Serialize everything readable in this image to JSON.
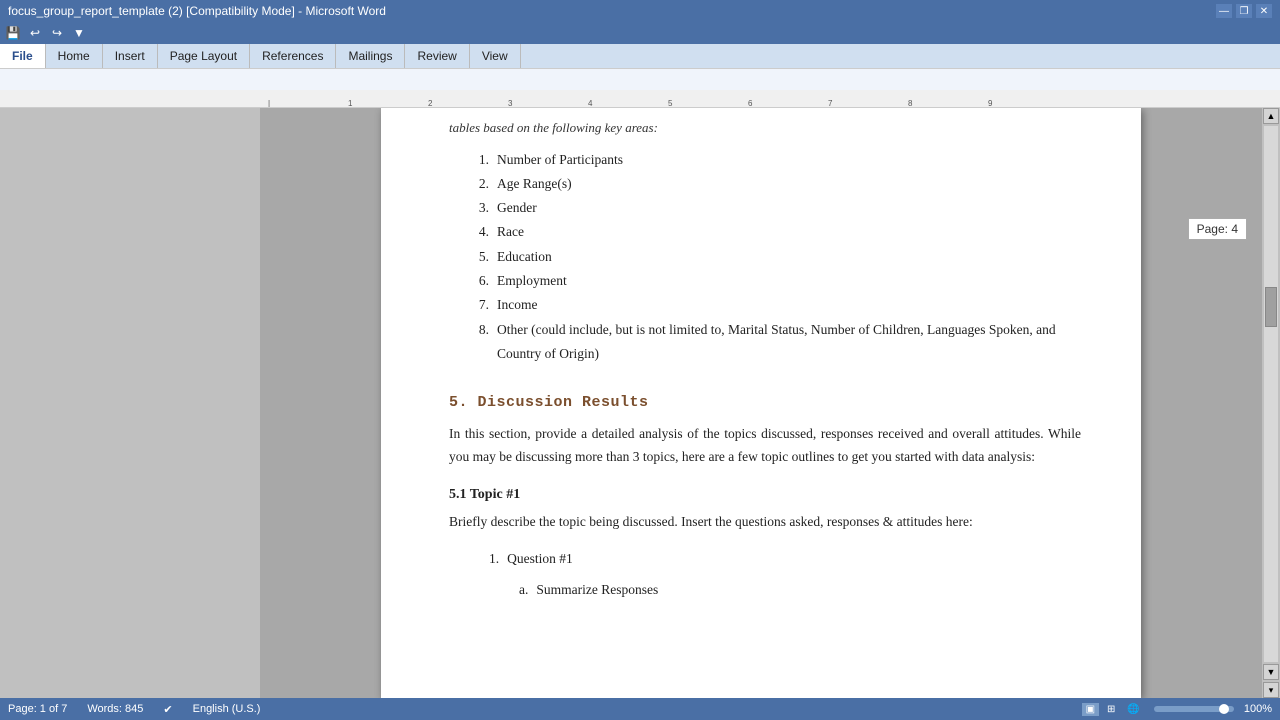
{
  "titlebar": {
    "title": "focus_group_report_template (2) [Compatibility Mode] - Microsoft Word",
    "minimize": "—",
    "restore": "❐",
    "close": "✕"
  },
  "quickaccess": {
    "icon1": "💾",
    "icon2": "↩",
    "icon3": "↪",
    "icon4": "📋"
  },
  "tabs": [
    {
      "label": "File",
      "active": true
    },
    {
      "label": "Home"
    },
    {
      "label": "Insert"
    },
    {
      "label": "Page Layout"
    },
    {
      "label": "References"
    },
    {
      "label": "Mailings"
    },
    {
      "label": "Review"
    },
    {
      "label": "View"
    }
  ],
  "page_indicator": "Page: 4",
  "intro_cutoff": "tables based on the following key areas:",
  "numbered_list": [
    {
      "num": "1.",
      "text": "Number of Participants"
    },
    {
      "num": "2.",
      "text": "Age Range(s)"
    },
    {
      "num": "3.",
      "text": "Gender"
    },
    {
      "num": "4.",
      "text": "Race"
    },
    {
      "num": "5.",
      "text": "Education"
    },
    {
      "num": "6.",
      "text": "Employment"
    },
    {
      "num": "7.",
      "text": "Income"
    },
    {
      "num": "8.",
      "text": "Other (could include, but is not limited to, Marital Status, Number of Children, Languages Spoken, and Country of Origin)"
    }
  ],
  "section5": {
    "heading": "5.  Discussion  Results",
    "body": "In this section, provide a detailed analysis of the topics discussed, responses received and overall attitudes.  While you may be discussing more than 3 topics, here are a few topic outlines to get you started with data analysis:"
  },
  "section51": {
    "heading": "5.1 Topic #1",
    "body": "Briefly describe the topic being discussed.   Insert the questions asked, responses & attitudes here:",
    "sublist": [
      {
        "num": "1.",
        "text": "Question #1"
      }
    ],
    "subsublist": [
      {
        "marker": "a.",
        "text": "Summarize Responses"
      }
    ]
  },
  "statusbar": {
    "page_info": "Page: 1 of 7",
    "words": "Words: 845",
    "language": "English (U.S.)",
    "zoom": "100%"
  }
}
